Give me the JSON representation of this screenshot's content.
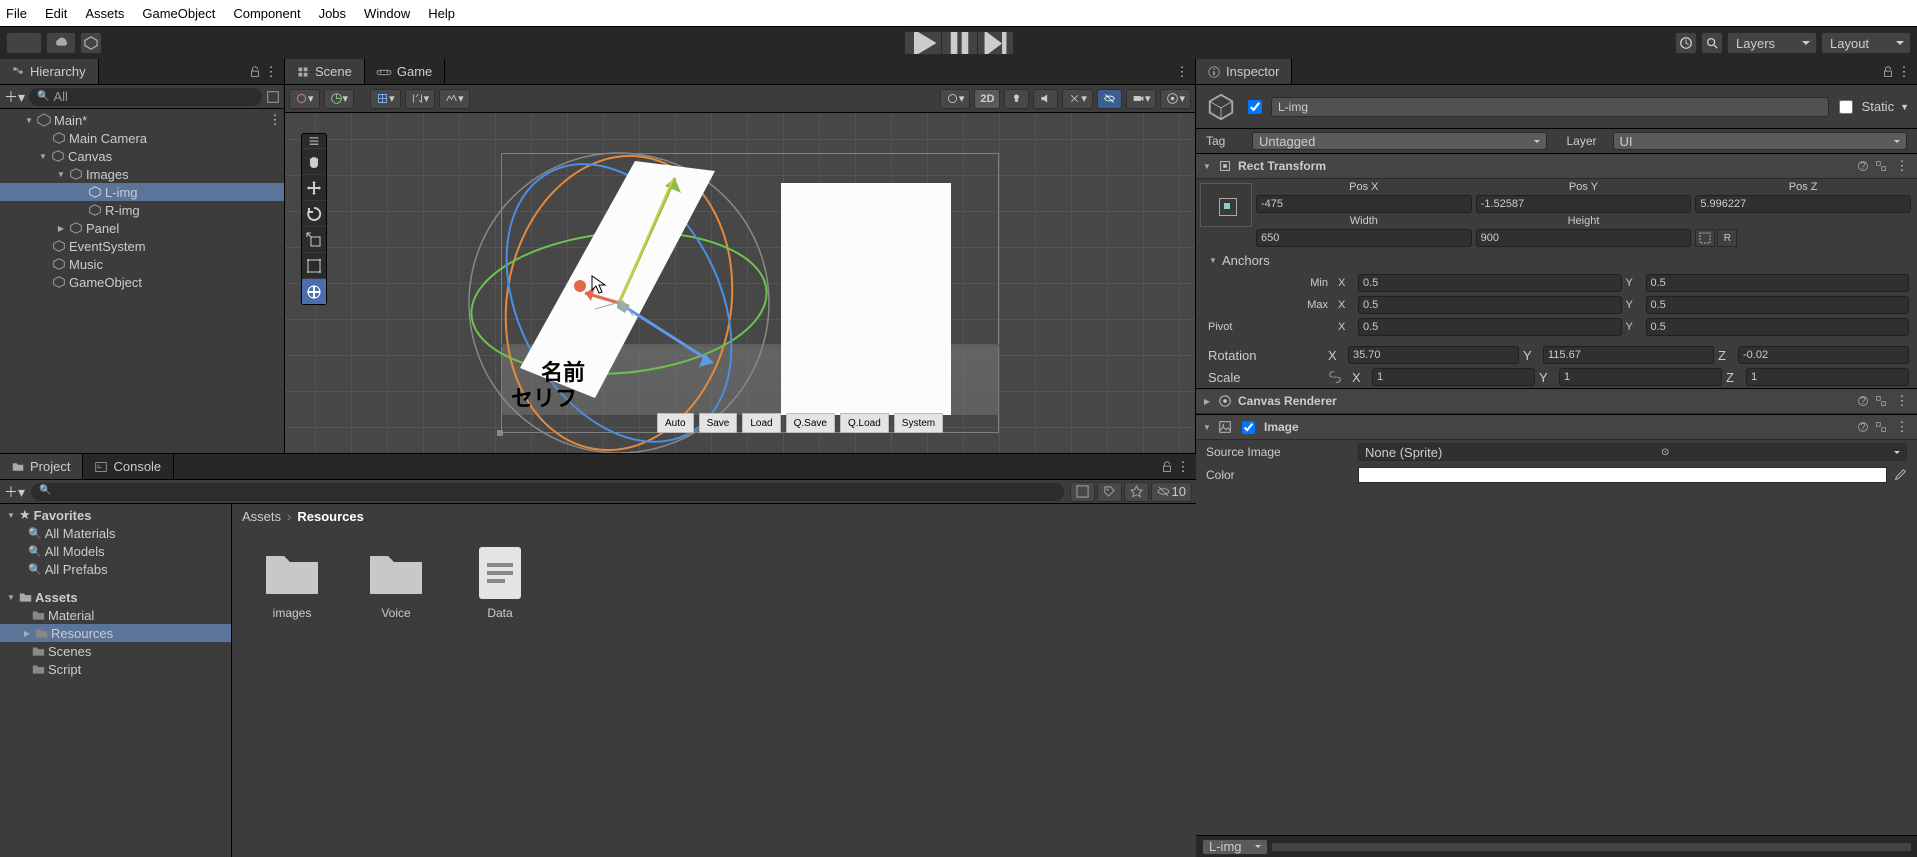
{
  "menu": {
    "items": [
      "File",
      "Edit",
      "Assets",
      "GameObject",
      "Component",
      "Jobs",
      "Window",
      "Help"
    ]
  },
  "toolbar": {
    "layers": "Layers",
    "layout": "Layout"
  },
  "hierarchy": {
    "title": "Hierarchy",
    "search_placeholder": "All",
    "root": "Main*",
    "items": [
      "Main Camera",
      "Canvas",
      "Images",
      "L-img",
      "R-img",
      "Panel",
      "EventSystem",
      "Music",
      "GameObject"
    ]
  },
  "scene": {
    "tab": "Scene",
    "game_tab": "Game",
    "mode": "2D",
    "name_label": "名前",
    "line_label": "セリフ",
    "popup": [
      "Auto",
      "Save",
      "Load",
      "Q.Save",
      "Q.Load",
      "System"
    ]
  },
  "project": {
    "tab": "Project",
    "console": "Console",
    "favorites": "Favorites",
    "fav_items": [
      "All Materials",
      "All Models",
      "All Prefabs"
    ],
    "assets": "Assets",
    "asset_items": [
      "Material",
      "Resources",
      "Scenes",
      "Script"
    ],
    "breadcrumb": {
      "root": "Assets",
      "cur": "Resources"
    },
    "grid": [
      {
        "name": "images",
        "type": "folder"
      },
      {
        "name": "Voice",
        "type": "folder"
      },
      {
        "name": "Data",
        "type": "file"
      }
    ],
    "hidden_count": "10"
  },
  "inspector": {
    "title": "Inspector",
    "object_name": "L-img",
    "static": "Static",
    "tag": "Tag",
    "tag_value": "Untagged",
    "layer": "Layer",
    "layer_value": "UI",
    "rect_transform": "Rect Transform",
    "posx": "Pos X",
    "posy": "Pos Y",
    "posz": "Pos Z",
    "posx_v": "-475",
    "posy_v": "-1.52587",
    "posz_v": "5.996227",
    "width": "Width",
    "height": "Height",
    "width_v": "650",
    "height_v": "900",
    "anchors": "Anchors",
    "min": "Min",
    "max": "Max",
    "min_x": "0.5",
    "min_y": "0.5",
    "max_x": "0.5",
    "max_y": "0.5",
    "pivot": "Pivot",
    "pivot_x": "0.5",
    "pivot_y": "0.5",
    "rotation": "Rotation",
    "rot_x": "35.70",
    "rot_y": "115.67",
    "rot_z": "-0.02",
    "scale": "Scale",
    "scale_x": "1",
    "scale_y": "1",
    "scale_z": "1",
    "canvas_renderer": "Canvas Renderer",
    "image": "Image",
    "source_image": "Source Image",
    "source_image_v": "None (Sprite)",
    "color": "Color",
    "bottom_sel": "L-img"
  }
}
